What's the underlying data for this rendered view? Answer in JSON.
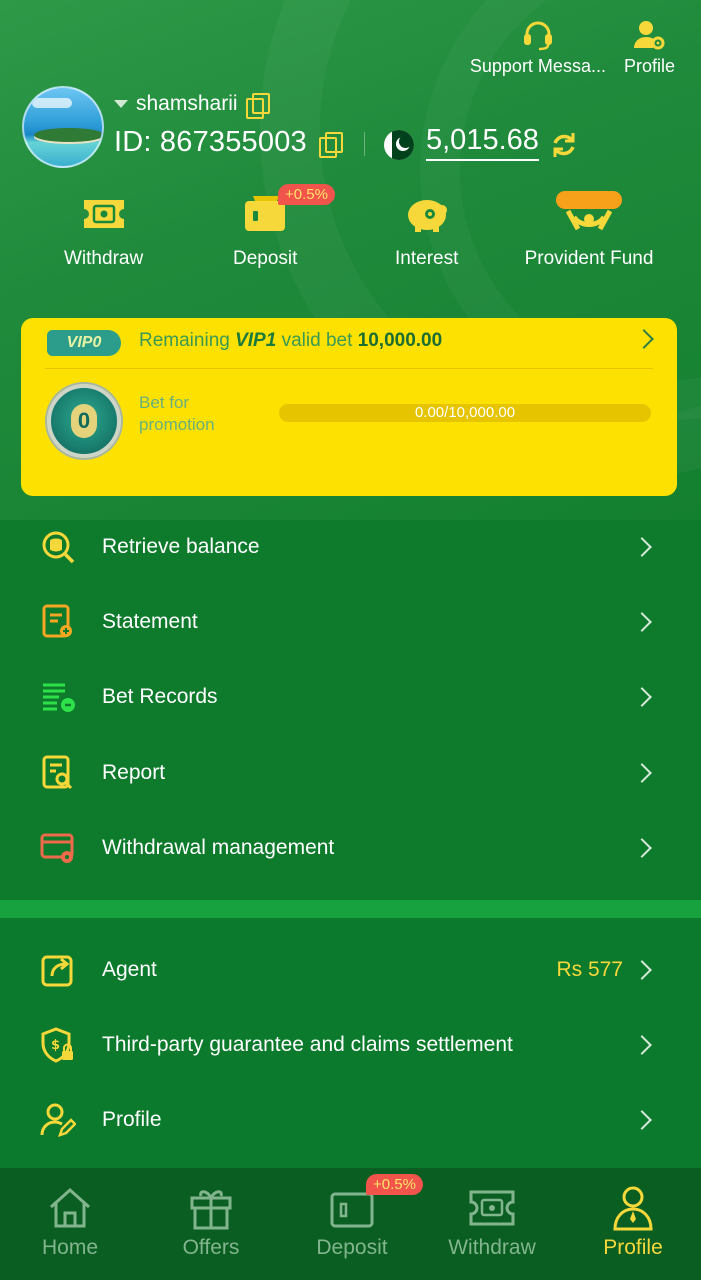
{
  "header": {
    "top_actions": [
      {
        "label": "Support Messa...",
        "icon": "headset-icon"
      },
      {
        "label": "Profile",
        "icon": "user-gear-icon"
      }
    ],
    "username": "shamsharii",
    "id_text": "ID: 867355003",
    "balance": "5,015.68",
    "currency_flag": "pakistan-flag-icon"
  },
  "quick_actions": [
    {
      "label": "Withdraw",
      "icon": "ticket-icon"
    },
    {
      "label": "Deposit",
      "icon": "wallet-icon",
      "badge": "+0.5%"
    },
    {
      "label": "Interest",
      "icon": "piggy-bank-icon"
    },
    {
      "label": "Provident Fund",
      "icon": "hands-coin-icon"
    }
  ],
  "vip": {
    "level_tag": "VIP0",
    "remaining_prefix": "Remaining",
    "next_level": "VIP1",
    "valid_bet_text": "valid bet",
    "amount": "10,000.00",
    "medal_level": "0",
    "bet_label": "Bet for promotion",
    "progress_text": "0.00/10,000.00",
    "progress_fraction": 0.0
  },
  "menu_main": [
    {
      "label": "Retrieve balance",
      "icon": "search-coins-icon"
    },
    {
      "label": "Statement",
      "icon": "statement-icon"
    },
    {
      "label": "Bet Records",
      "icon": "bet-records-icon"
    },
    {
      "label": "Report",
      "icon": "report-icon"
    },
    {
      "label": "Withdrawal management",
      "icon": "card-gear-icon"
    }
  ],
  "menu_secondary": [
    {
      "label": "Agent",
      "icon": "share-icon",
      "value": "Rs 577"
    },
    {
      "label": "Third-party guarantee and claims settlement",
      "icon": "shield-lock-icon"
    },
    {
      "label": "Profile",
      "icon": "user-edit-icon"
    }
  ],
  "bottom_nav": [
    {
      "label": "Home",
      "icon": "home-icon"
    },
    {
      "label": "Offers",
      "icon": "gift-icon"
    },
    {
      "label": "Deposit",
      "icon": "wallet-icon",
      "badge": "+0.5%"
    },
    {
      "label": "Withdraw",
      "icon": "ticket-icon"
    },
    {
      "label": "Profile",
      "icon": "user-icon",
      "active": true
    }
  ],
  "colors": {
    "accent": "#f7d83a",
    "primary_green": "#0d7a2c",
    "vip_yellow": "#fde100",
    "badge_red": "#f1544a"
  }
}
